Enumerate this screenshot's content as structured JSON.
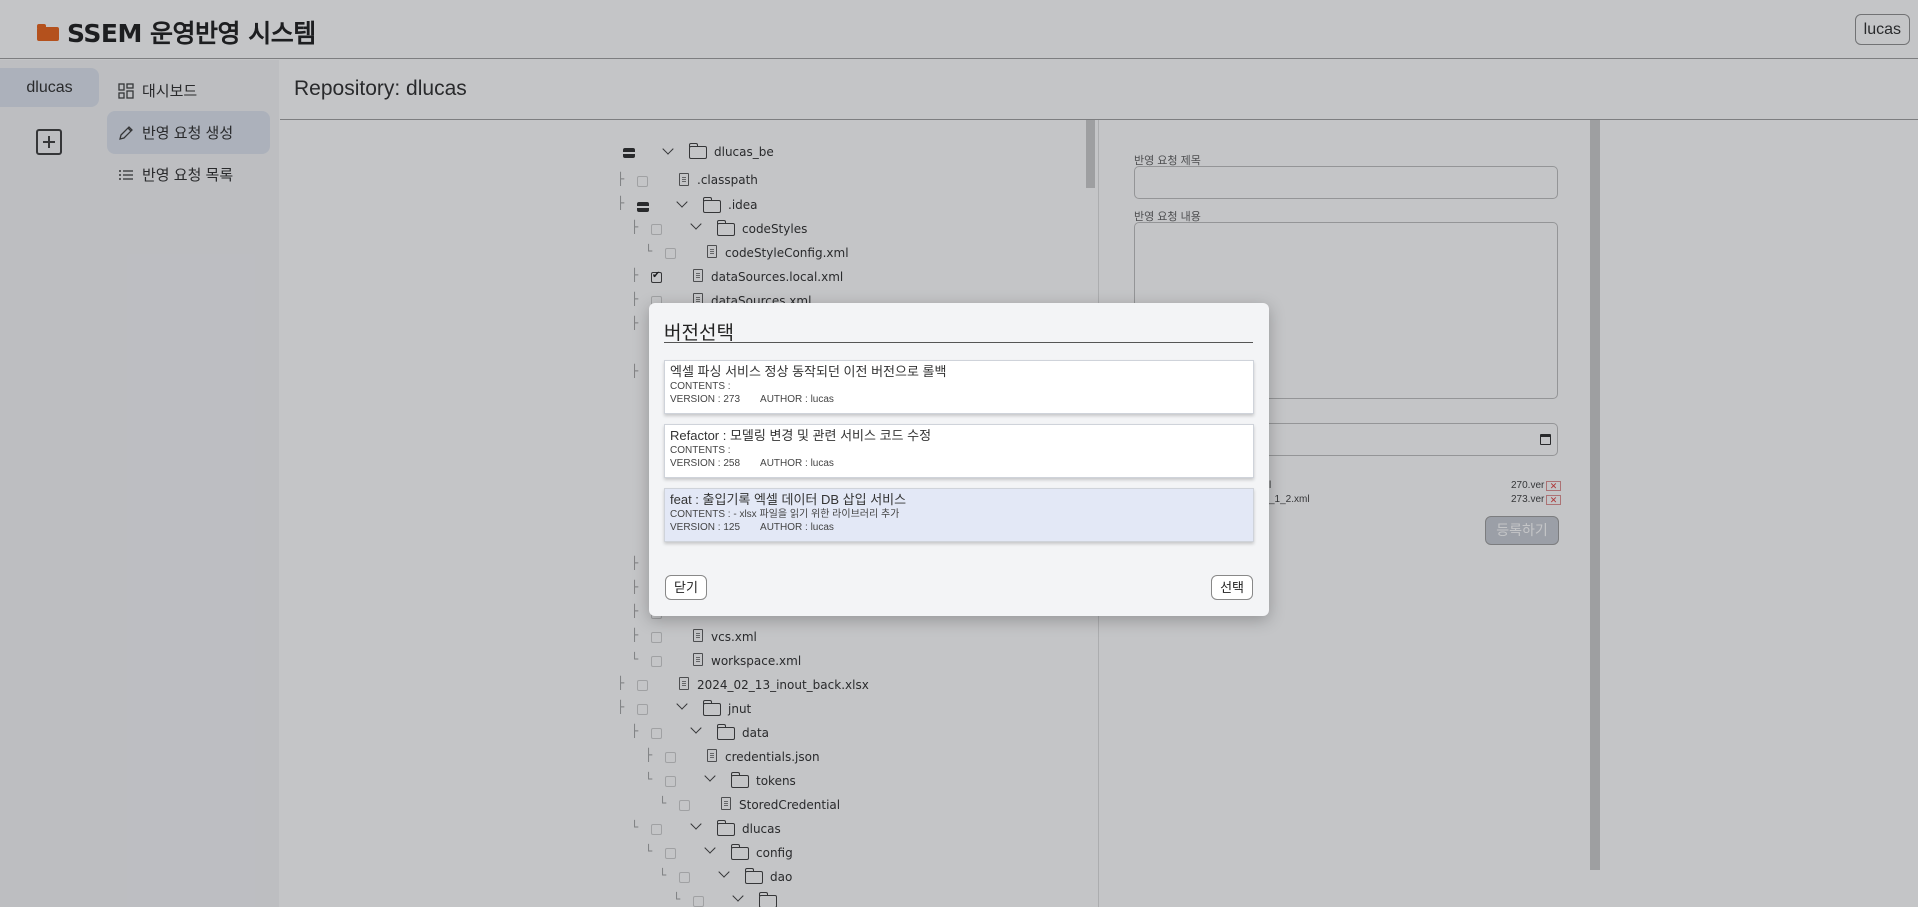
{
  "header": {
    "title": "SSEM 운영반영 시스템",
    "user_button": "lucas",
    "brand_icon": "folder-icon",
    "brand_color": "#e8590c"
  },
  "rail": {
    "repo_label": "dlucas",
    "add_icon": "add-repo-icon"
  },
  "menu": {
    "items": [
      {
        "label": "대시보드",
        "icon": "dashboard-icon",
        "active": false
      },
      {
        "label": "반영 요청 생성",
        "icon": "pencil-icon",
        "active": true
      },
      {
        "label": "반영 요청 목록",
        "icon": "list-icon",
        "active": false
      }
    ]
  },
  "main": {
    "title": "Repository: dlucas"
  },
  "tree": {
    "rows": [
      {
        "label": "dlucas_be",
        "type": "folder"
      },
      {
        "label": ".classpath",
        "type": "file"
      },
      {
        "label": ".idea",
        "type": "folder"
      },
      {
        "label": "codeStyles",
        "type": "folder"
      },
      {
        "label": "codeStyleConfig.xml",
        "type": "file"
      },
      {
        "label": "dataSources.local.xml",
        "type": "file",
        "checked": true
      },
      {
        "label": "dataSources.xml",
        "type": "file"
      },
      {
        "label": "vcs.xml",
        "type": "file"
      },
      {
        "label": "workspace.xml",
        "type": "file"
      },
      {
        "label": "2024_02_13_inout_back.xlsx",
        "type": "file"
      },
      {
        "label": "jnut",
        "type": "folder"
      },
      {
        "label": "data",
        "type": "folder"
      },
      {
        "label": "credentials.json",
        "type": "file"
      },
      {
        "label": "tokens",
        "type": "folder"
      },
      {
        "label": "StoredCredential",
        "type": "file"
      },
      {
        "label": "dlucas",
        "type": "folder"
      },
      {
        "label": "config",
        "type": "folder"
      },
      {
        "label": "dao",
        "type": "folder"
      }
    ]
  },
  "form": {
    "title_label": "반영 요청 제목",
    "title_value": "",
    "content_label": "반영 요청 내용",
    "content_value": "",
    "attachments": [
      {
        "name": "l",
        "version": "270.ver"
      },
      {
        "name": "_1_2.xml",
        "version": "273.ver"
      }
    ],
    "register_button": "등록하기"
  },
  "modal": {
    "title": "버전선택",
    "versions": [
      {
        "title": "엑셀 파싱 서비스 정상 동작되던 이전 버전으로 롤백",
        "contents": "CONTENTS :",
        "version": "VERSION : 273",
        "author": "AUTHOR : lucas",
        "selected": false
      },
      {
        "title": "Refactor : 모델링 변경 및 관련 서비스 코드 수정",
        "contents": "CONTENTS :",
        "version": "VERSION : 258",
        "author": "AUTHOR : lucas",
        "selected": false
      },
      {
        "title": "feat : 출입기록 엑셀 데이터 DB 삽입 서비스",
        "contents": "CONTENTS : - xlsx 파일을 읽기 위한 라이브러리 추가",
        "version": "VERSION : 125",
        "author": "AUTHOR : lucas",
        "selected": true
      }
    ],
    "close_button": "닫기",
    "select_button": "선택"
  }
}
